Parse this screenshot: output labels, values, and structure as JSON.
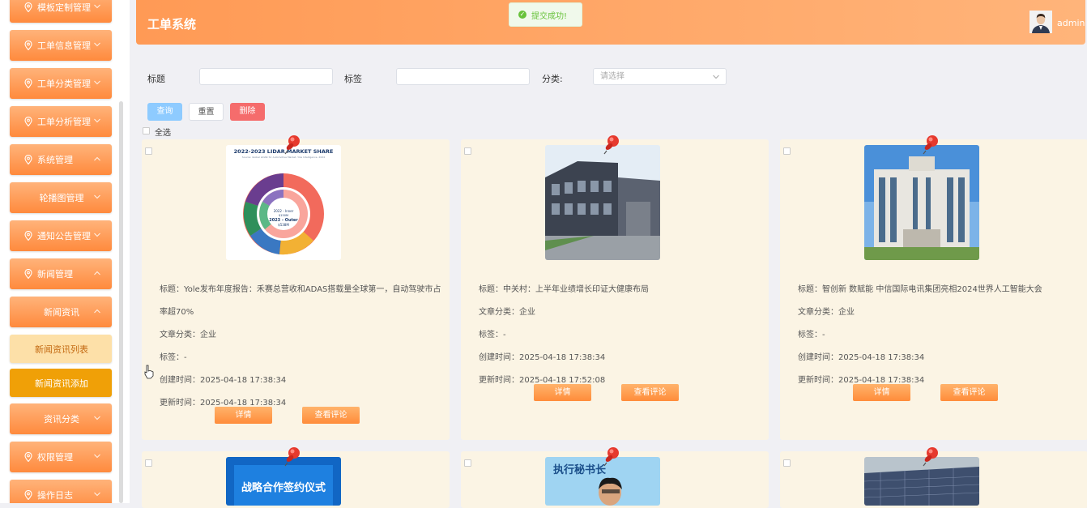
{
  "app": {
    "title": "工单系统",
    "user": "admin"
  },
  "toast": {
    "message": "提交成功!"
  },
  "sidebar": {
    "items": [
      {
        "label": "模板定制管理",
        "icon": "location-pin-icon",
        "arrow": "chevron-down-icon"
      },
      {
        "label": "工单信息管理",
        "icon": "location-pin-icon",
        "arrow": "chevron-down-icon"
      },
      {
        "label": "工单分类管理",
        "icon": "location-pin-icon",
        "arrow": "chevron-down-icon"
      },
      {
        "label": "工单分析管理",
        "icon": "location-pin-icon",
        "arrow": "chevron-down-icon"
      },
      {
        "label": "系统管理",
        "icon": "location-pin-icon",
        "arrow": "chevron-up-icon"
      },
      {
        "label": "轮播图管理",
        "arrow": "chevron-down-icon"
      },
      {
        "label": "通知公告管理",
        "icon": "location-pin-icon",
        "arrow": "chevron-down-icon"
      },
      {
        "label": "新闻管理",
        "icon": "location-pin-icon",
        "arrow": "chevron-up-icon"
      },
      {
        "label": "新闻资讯",
        "arrow": "chevron-up-icon"
      },
      {
        "label": "新闻资讯列表"
      },
      {
        "label": "新闻资讯添加"
      },
      {
        "label": "资讯分类",
        "arrow": "chevron-down-icon"
      },
      {
        "label": "权限管理",
        "icon": "location-pin-icon",
        "arrow": "chevron-down-icon"
      },
      {
        "label": "操作日志",
        "icon": "location-pin-icon",
        "arrow": "chevron-down-icon"
      }
    ]
  },
  "filters": {
    "title_label": "标题",
    "tag_label": "标签",
    "category_label": "分类:",
    "title_value": "",
    "tag_value": "",
    "category_placeholder": "请选择",
    "query_button": "查询",
    "reset_button": "重置",
    "delete_button": "删除",
    "select_all": "全选"
  },
  "cards": [
    {
      "title_lines": [
        "标题：Yole发布年度报告：禾赛总营收和ADAS搭载量全球第一，自动驾驶市占",
        "率超70%"
      ],
      "category": "文章分类：企业",
      "tags": "标签：-",
      "created": "创建时间：2025-04-18 17:38:34",
      "updated": "更新时间：2025-04-18 17:38:34",
      "image": "lidar-market-share-chart",
      "thumb_text": {
        "heading": "2022-2023 LIDAR MARKET SHARE",
        "source": "Source: Global LiDAR for Automotive Market, Yole Intelligence, 2024",
        "center_top": "2022 - Inner",
        "center_top_value": "$150M",
        "center_bottom": "2023 - Outer",
        "center_bottom_value": "$538M"
      }
    },
    {
      "title_lines": [
        "标题：中关村：上半年业绩增长印证大健康布局"
      ],
      "category": "文章分类：企业",
      "tags": "标签：-",
      "created": "创建时间：2025-04-18 17:38:34",
      "updated": "更新时间：2025-04-18 17:52:08",
      "image": "factory-building-photo"
    },
    {
      "title_lines": [
        "标题：智创新 数赋能 中信国际电讯集团亮相2024世界人工智能大会"
      ],
      "category": "文章分类：企业",
      "tags": "标签：-",
      "created": "创建时间：2025-04-18 17:38:34",
      "updated": "更新时间：2025-04-18 17:38:34",
      "image": "office-building-photo"
    },
    {
      "image": "signing-ceremony-photo",
      "thumb_text": {
        "banner": "战略合作签约仪式"
      }
    },
    {
      "image": "speaker-photo",
      "thumb_text": {
        "banner": "执行秘书长"
      }
    },
    {
      "image": "solar-roof-photo"
    }
  ],
  "card_buttons": {
    "detail": "详情",
    "comments": "查看评论"
  },
  "colors": {
    "accent": "#ff8c3a",
    "header": "#ffa565",
    "card_bg": "#fbf4e4",
    "query": "#8ecbff",
    "delete": "#f56c6c",
    "success": "#67c23a"
  }
}
